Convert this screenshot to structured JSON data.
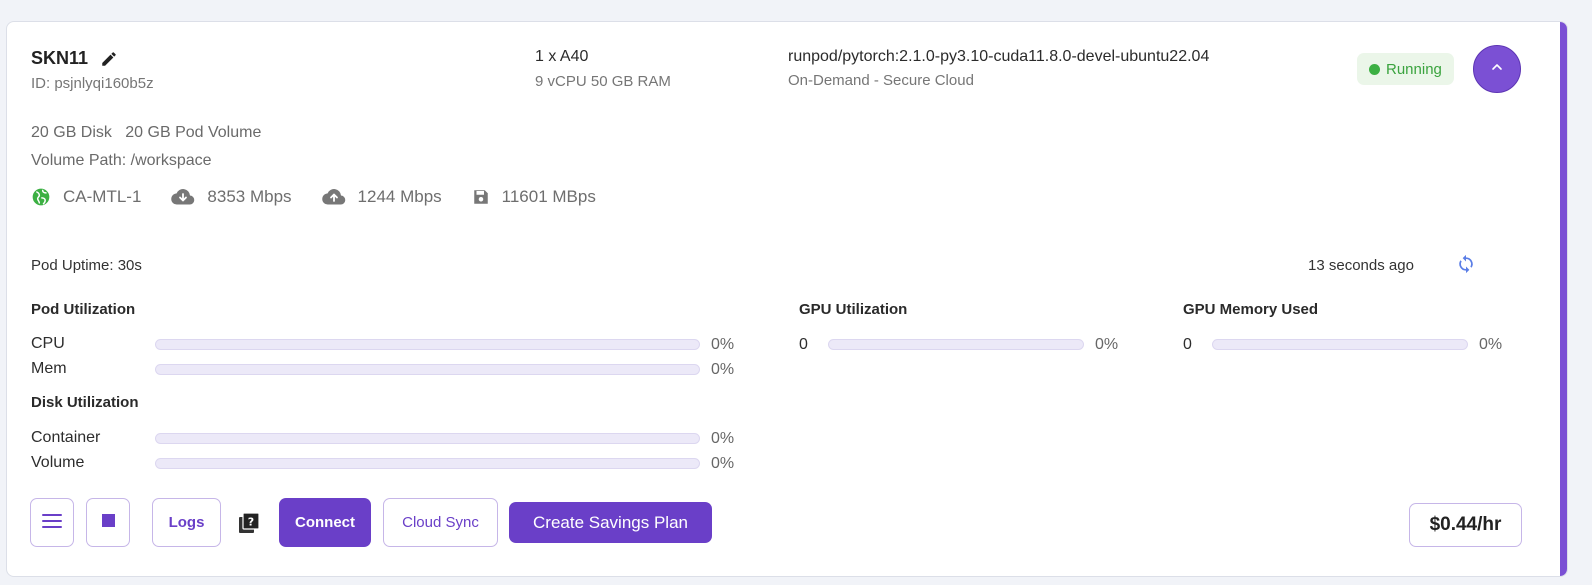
{
  "pod": {
    "name": "SKN11",
    "id_label": "ID: psjnlyqi160b5z",
    "gpu": "1 x A40",
    "resources": "9 vCPU 50 GB RAM",
    "image": "runpod/pytorch:2.1.0-py3.10-cuda11.8.0-devel-ubuntu22.04",
    "plan": "On-Demand - Secure Cloud",
    "status": "Running",
    "disk": "20 GB Disk",
    "pod_volume": "20 GB Pod Volume",
    "volume_path": "Volume Path: /workspace"
  },
  "network": {
    "region": "CA-MTL-1",
    "download": "8353 Mbps",
    "upload": "1244 Mbps",
    "disk_speed": "11601 MBps"
  },
  "uptime": {
    "label": "Pod Uptime: 30s",
    "last_updated": "13 seconds ago"
  },
  "utilization": {
    "pod_heading": "Pod Utilization",
    "cpu_label": "CPU",
    "cpu_pct": "0%",
    "cpu_value": 0,
    "mem_label": "Mem",
    "mem_pct": "0%",
    "mem_value": 0,
    "disk_heading": "Disk Utilization",
    "container_label": "Container",
    "container_pct": "0%",
    "container_value": 0,
    "volume_label": "Volume",
    "volume_pct": "0%",
    "volume_value": 0,
    "gpu_heading": "GPU Utilization",
    "gpu_index": "0",
    "gpu_pct": "0%",
    "gpu_value": 0,
    "gpu_mem_heading": "GPU Memory Used",
    "gpu_mem_index": "0",
    "gpu_mem_pct": "0%",
    "gpu_mem_value": 0
  },
  "actions": {
    "logs": "Logs",
    "connect": "Connect",
    "cloud_sync": "Cloud Sync",
    "savings_plan": "Create Savings Plan",
    "price": "$0.44/hr"
  },
  "icons": {
    "edit": "pencil-icon",
    "collapse": "chevron-up-icon",
    "region": "globe-icon",
    "download": "cloud-download-icon",
    "upload": "cloud-upload-icon",
    "disk": "floppy-disk-icon",
    "refresh": "refresh-icon",
    "menu": "hamburger-menu-icon",
    "stop": "stop-icon",
    "help": "help-book-icon"
  },
  "colors": {
    "accent": "#7b50d4",
    "button": "#6a3fc8",
    "running": "#3cb043",
    "bar_track": "#ece9f8"
  }
}
